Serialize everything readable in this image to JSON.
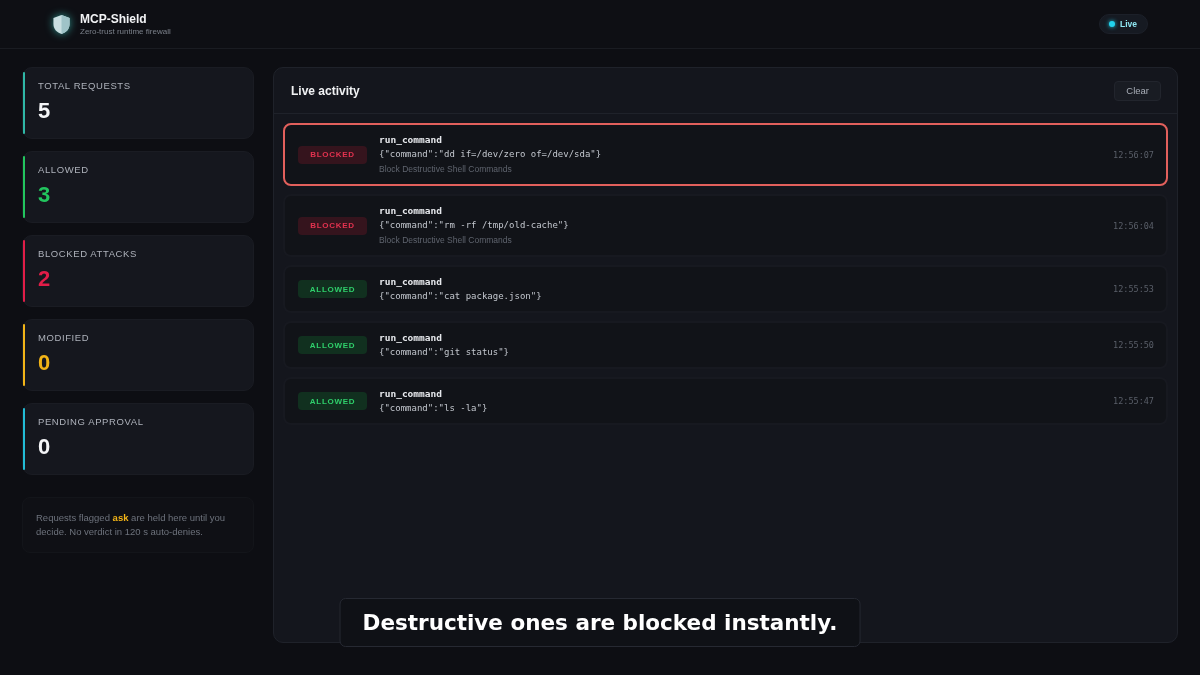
{
  "app": {
    "title": "MCP-Shield",
    "subtitle": "Zero-trust runtime firewall"
  },
  "status": {
    "label": "Live"
  },
  "stats": [
    {
      "label": "TOTAL REQUESTS",
      "value": "5",
      "color": "#2fb7a6",
      "kind": "plain"
    },
    {
      "label": "ALLOWED",
      "value": "3",
      "color": "#22c55e",
      "kind": "tinted"
    },
    {
      "label": "BLOCKED ATTACKS",
      "value": "2",
      "color": "#e11d48",
      "kind": "tinted"
    },
    {
      "label": "MODIFIED",
      "value": "0",
      "color": "#f2b417",
      "kind": "tinted"
    },
    {
      "label": "PENDING APPROVAL",
      "value": "0",
      "color": "#22bcd6",
      "kind": "plain"
    }
  ],
  "note": "Requests flagged **ask** are held here until you decide. No verdict in 120 s auto-denies.",
  "activity": {
    "title": "Live activity",
    "clear_button": "Clear",
    "events": [
      {
        "verdict": "BLOCKED",
        "kind": "blocked",
        "selected": true,
        "tool": "run_command",
        "args": "{\"command\":\"dd if=/dev/zero of=/dev/sda\"}",
        "rule": "Block Destructive Shell Commands",
        "time": "12:56:07"
      },
      {
        "verdict": "BLOCKED",
        "kind": "blocked",
        "selected": false,
        "tool": "run_command",
        "args": "{\"command\":\"rm -rf /tmp/old-cache\"}",
        "rule": "Block Destructive Shell Commands",
        "time": "12:56:04"
      },
      {
        "verdict": "ALLOWED",
        "kind": "allowed",
        "selected": false,
        "tool": "run_command",
        "args": "{\"command\":\"cat package.json\"}",
        "time": "12:55:53"
      },
      {
        "verdict": "ALLOWED",
        "kind": "allowed",
        "selected": false,
        "tool": "run_command",
        "args": "{\"command\":\"git status\"}",
        "time": "12:55:50"
      },
      {
        "verdict": "ALLOWED",
        "kind": "allowed",
        "selected": false,
        "tool": "run_command",
        "args": "{\"command\":\"ls -la\"}",
        "time": "12:55:47"
      }
    ]
  },
  "caption": "Destructive ones are blocked instantly."
}
